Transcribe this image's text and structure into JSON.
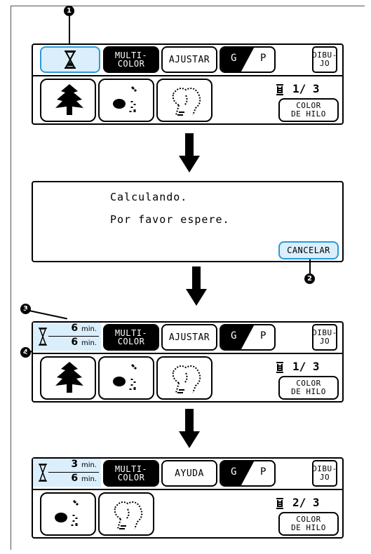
{
  "callouts": {
    "c1": "1",
    "c2": "2",
    "c3": "3",
    "c4": "4"
  },
  "screen1": {
    "multi_line1": "MULTI-",
    "multi_line2": "COLOR",
    "mid_button": "AJUSTAR",
    "g": "G",
    "p": "P",
    "dibujo_line1": "DIBU-",
    "dibujo_line2": "JO",
    "counter": "1/ 3",
    "thread_line1": "COLOR",
    "thread_line2": "DE HILO"
  },
  "dialog": {
    "line1": "Calculando.",
    "line2": "Por favor espere.",
    "cancel": "CANCELAR"
  },
  "screen3": {
    "time_top": "6",
    "time_bottom": "6",
    "unit": "min.",
    "multi_line1": "MULTI-",
    "multi_line2": "COLOR",
    "mid_button": "AJUSTAR",
    "g": "G",
    "p": "P",
    "dibujo_line1": "DIBU-",
    "dibujo_line2": "JO",
    "counter": "1/ 3",
    "thread_line1": "COLOR",
    "thread_line2": "DE HILO"
  },
  "screen4": {
    "time_top": "3",
    "time_bottom": "6",
    "unit": "min.",
    "multi_line1": "MULTI-",
    "multi_line2": "COLOR",
    "mid_button": "AYUDA",
    "g": "G",
    "p": "P",
    "dibujo_line1": "DIBU-",
    "dibujo_line2": "JO",
    "counter": "2/ 3",
    "thread_line1": "COLOR",
    "thread_line2": "DE HILO"
  },
  "colors": {
    "highlight": "#dbeefb",
    "highlight_border": "#2a9ad8"
  },
  "icons": [
    "hourglass-icon",
    "spool-icon",
    "down-arrow-icon",
    "tree-stitch-icon",
    "bird-stitch-icon",
    "goat-stitch-icon"
  ]
}
